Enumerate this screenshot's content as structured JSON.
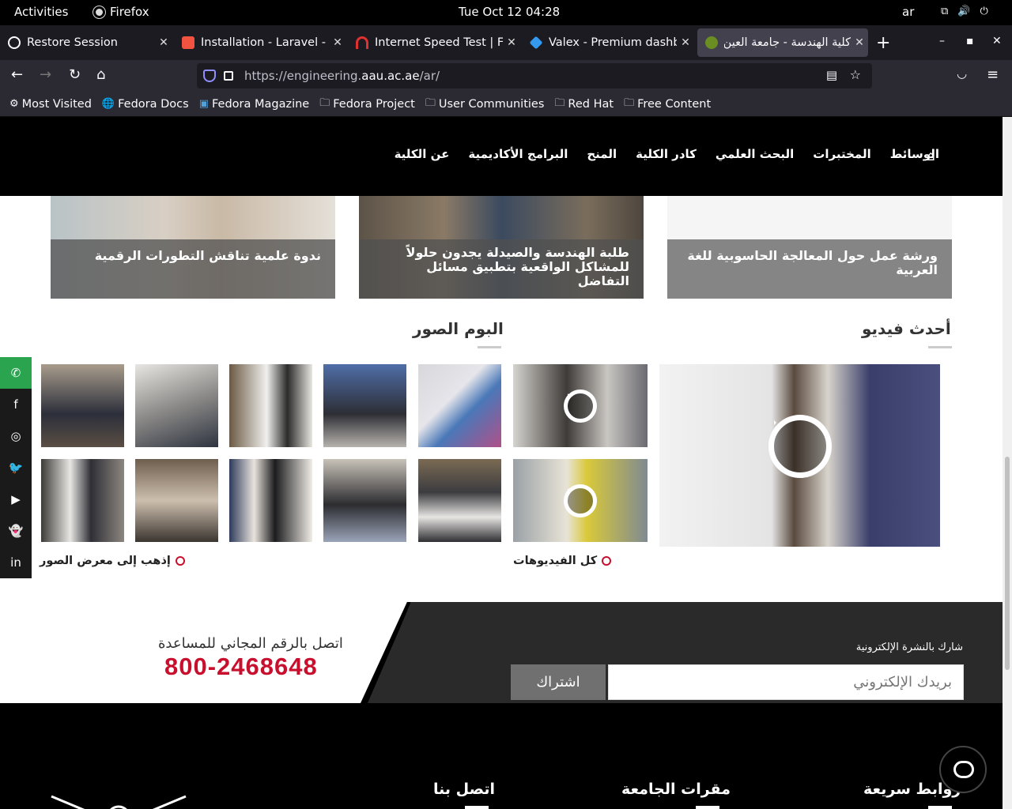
{
  "gnome": {
    "activities": "Activities",
    "app": "Firefox",
    "clock": "Tue Oct 12  04:28",
    "lang": "ar"
  },
  "tabs": [
    {
      "title": "Restore Session"
    },
    {
      "title": "Installation - Laravel - Th"
    },
    {
      "title": "Internet Speed Test | Fast"
    },
    {
      "title": "Valex - Premium dashboar"
    },
    {
      "title": "كلية الهندسة - جامعة العين"
    }
  ],
  "url": {
    "prefix": "https://engineering.",
    "domain": "aau.ac.ae",
    "path": "/ar/"
  },
  "bookmarks": [
    "Most Visited",
    "Fedora Docs",
    "Fedora Magazine",
    "Fedora Project",
    "User Communities",
    "Red Hat",
    "Free Content"
  ],
  "nav": [
    "عن الكلية",
    "البرامج الأكاديمية",
    "المنح",
    "كادر الكلية",
    "البحث العلمي",
    "المختبرات",
    "الوسائط"
  ],
  "news": [
    {
      "title": "ندوة علمية تناقش التطورات الرقمية"
    },
    {
      "title": "طلبة الهندسة والصيدلة يجدون حلولاً للمشاكل الواقعية بتطبيق مسائل التفاضل"
    },
    {
      "title": "ورشة عمل حول المعالجة الحاسوبية للغة العربية"
    }
  ],
  "sections": {
    "photos": "البوم الصور",
    "videos": "أحدث فيديو",
    "photos_link": "إذهب إلى معرض الصور",
    "videos_link": "كل الفيديوهات"
  },
  "footer": {
    "help_text": "اتصل بالرقم المجاني للمساعدة",
    "phone": "800-2468648",
    "newsletter_label": "شارك بالنشرة الإلكترونية",
    "email_placeholder": "بريدك الإلكتروني",
    "subscribe": "اشتراك",
    "col1": "روابط سريعة",
    "col2": "مقرات الجامعة",
    "col3": "اتصل بنا"
  },
  "colors": {
    "accent": "#c8102e",
    "whatsapp": "#2aa44f"
  }
}
